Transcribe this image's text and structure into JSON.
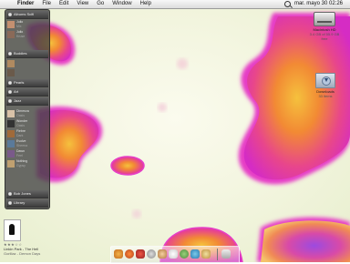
{
  "menubar": {
    "apple_icon": "",
    "items": [
      "Finder",
      "File",
      "Edit",
      "View",
      "Go",
      "Window",
      "Help"
    ],
    "spotlight_icon": "spotlight-icon",
    "clock": "mar. mayo 30  02:26"
  },
  "drawer": {
    "sections": [
      {
        "label": "Albums Scifi"
      },
      {
        "label": "Buddies"
      },
      {
        "label": "Pearls"
      },
      {
        "label": "Art"
      },
      {
        "label": "Jazz"
      },
      {
        "label": "Bob Jones"
      },
      {
        "label": "Library"
      }
    ],
    "tracks": [
      {
        "title": "Julio",
        "sub": "Mix"
      },
      {
        "title": "Julio",
        "sub": "Kruse"
      },
      {
        "title": "Dimenza",
        "sub": "Oasis"
      },
      {
        "title": "Wonder",
        "sub": "Oasis"
      },
      {
        "title": "Fiebre",
        "sub": "Dark"
      },
      {
        "title": "Evolve",
        "sub": "Sheena"
      },
      {
        "title": "Dawn",
        "sub": "Feel"
      },
      {
        "title": "Nothing",
        "sub": "Gypsy"
      }
    ]
  },
  "desktop": {
    "icons": [
      {
        "name": "Macintosh HD",
        "sub": "3.4 GB of 55.9 GB free",
        "icon": "hard-drive-icon"
      },
      {
        "name": "Downloads",
        "sub": "33 items",
        "icon": "downloads-folder-icon"
      }
    ]
  },
  "now_playing": {
    "track": "Linkin Park - The Hell",
    "sub": "Gorillaz - Demon Days",
    "stars": "★★★☆☆"
  },
  "colors": {
    "wall_base": "#f4f6e4",
    "wall_magenta": "#ef3fc3",
    "wall_orange": "#f08a35",
    "wall_yellow": "#fbd35a",
    "wall_purple": "#8a3fd0"
  }
}
